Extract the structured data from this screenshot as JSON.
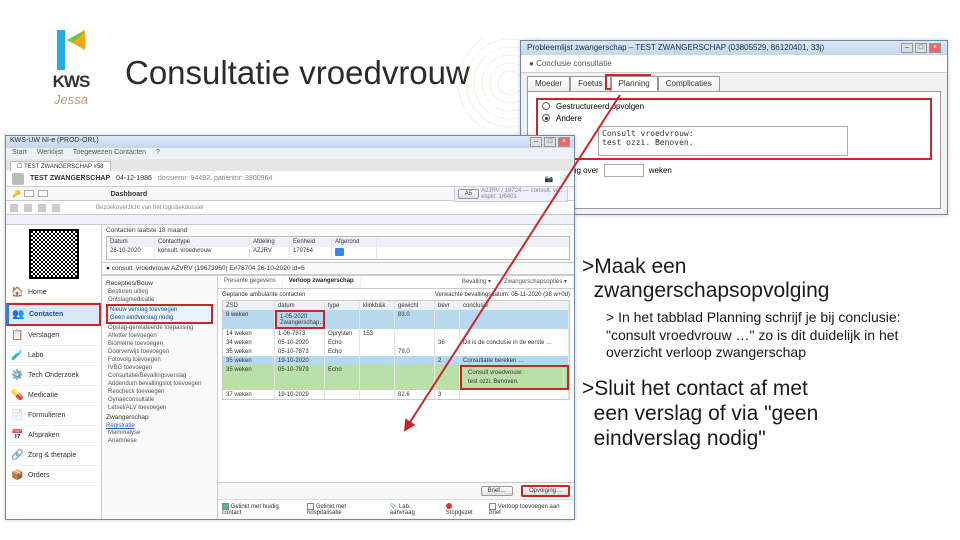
{
  "logo": {
    "text": "KWS",
    "sub": "Jessa"
  },
  "main_title": "Consultatie vroedvrouw",
  "popup": {
    "title": "Probleemlijst zwangerschap – TEST ZWANGERSCHAP (03805529, 86120401, 33j)",
    "subtitle": "Conclusie consultatie",
    "tabs": [
      "Moeder",
      "Foetus",
      "Planning",
      "Complicaties"
    ],
    "active_tab": "Planning",
    "radios": {
      "r1": "Gestructureerd opvolgen",
      "r2": "Andere"
    },
    "textarea_lines": [
      "Consult vroedvrouw:",
      "test ozzi. Benoven."
    ],
    "followup_label": "Raadpleging over",
    "followup_unit": "weken"
  },
  "app_window": {
    "title": "KWS-UW NI-e (PROD-ORL)",
    "menu": [
      "Start",
      "Werklijst",
      "Toegewezen Contacten",
      "?"
    ],
    "tab_label": "TEST ZWANGERSCHAP #58",
    "patient": {
      "name": "TEST ZWANGERSCHAP",
      "dob": "04-12-1986",
      "info": "dossiernr: 94492. patiëntnr: 3800964",
      "key_label": "A5"
    },
    "dashboard_label": "Dashboard",
    "right_widget": {
      "l1": "A2JRV / 19724 — consult. vr…",
      "l2": "esplit: 1/6401"
    },
    "breadcrumb": "Bezoekoverzicht van het logistiekdossier"
  },
  "sidebar": [
    {
      "icon": "🏠",
      "label": "Home"
    },
    {
      "icon": "👥",
      "label": "Contacten",
      "active": true
    },
    {
      "icon": "📋",
      "label": "Verslagen"
    },
    {
      "icon": "🧪",
      "label": "Labo"
    },
    {
      "icon": "⚙️",
      "label": "Tech Onderzoek"
    },
    {
      "icon": "💊",
      "label": "Medicatie"
    },
    {
      "icon": "📄",
      "label": "Formulieren"
    },
    {
      "icon": "📅",
      "label": "Afspraken"
    },
    {
      "icon": "🔗",
      "label": "Zorg & therapie"
    },
    {
      "icon": "📦",
      "label": "Orders"
    }
  ],
  "contacts_panel": {
    "header": "Contacten laatste 18 maand",
    "cols": [
      "Datum",
      "Contacttype",
      "Afdeling",
      "Eenheid",
      "Afgerond"
    ],
    "row": {
      "datum": "28-10-2020",
      "type": "konsult. vroedvrouw",
      "afd": "AZJRV",
      "eenh": "179764",
      "badge": true
    }
  },
  "consult": {
    "title": "consult. vroedvrouw AZVRV (19673960)  E#78704  26-10-2020 id=6",
    "left": {
      "sec1_title": "Recepties/Bouw",
      "sec1_items": [
        "Besturen uitleg",
        "Ontslagmedicatie"
      ],
      "sec2_items": [
        "Nieuw verslag toevoegen",
        "Geen eindverslag nodig"
      ],
      "sec3_items": [
        "Opslag-gerelateerde toepassing",
        "Afletter toevoegen",
        "Biometrie toevoegen",
        "Doorverwijs toevoegen",
        "Fotovolg toevoegen",
        "IVBG toevoegen",
        "Consultatie/Bevallingsverslag",
        "Addendum bevallingslot toevoegen",
        "Reocheck toevoegen",
        "Gynaeconsultatie",
        "Letsel/ALV toevoegen"
      ],
      "sec4_title": "Zwangerschap",
      "sec4_link": "Registratie",
      "sec4_items": [
        "Mammalyse",
        "Anamnese"
      ]
    },
    "tabs": [
      "Presente gegevens",
      "Verloop zwangerschap"
    ],
    "tabs_right": [
      "Bevalling ▾",
      "Zwangerschapsopties ▾"
    ],
    "header_left": "Geplande ambulante contacten",
    "header_right": "Verwachte bevallingsdatum: 05-11-2020 (38 w+0d)",
    "cols": [
      "ZSD",
      "datum",
      "type",
      "klinkb&k",
      "gewicht",
      "bevr",
      "conclusie"
    ],
    "rows": [
      {
        "z": "8 weken",
        "d": "1-05-2020",
        "t": "Zwangerschap…",
        "k": "",
        "g": "83.0",
        "b": "",
        "c": "",
        "cls": "row-blue",
        "redcell": true
      },
      {
        "z": "14 weken",
        "d": "1-06-7873",
        "t": "Oprysten",
        "k": "153",
        "g": "",
        "b": "",
        "c": ""
      },
      {
        "z": "34 weken",
        "d": "05-10-2020",
        "t": "Echo",
        "k": "",
        "g": "",
        "b": "36",
        "c": "Dit is de conclusie in de eerste …"
      },
      {
        "z": "35 weken",
        "d": "05-10-7873",
        "t": "Echo",
        "k": "",
        "g": "79.0",
        "b": "",
        "c": ""
      },
      {
        "z": "35 weken",
        "d": "19-10-2020",
        "t": "",
        "k": "",
        "g": "",
        "b": "2",
        "c": "Consultatie bereken …",
        "cls": "row-blue"
      },
      {
        "z": "35 weken",
        "d": "05-10-7879",
        "t": "Echo",
        "k": "",
        "g": "",
        "b": "",
        "c": "",
        "cls": "row-green",
        "redconc": true,
        "conc_l1": "Consult vroedvrouw:",
        "conc_l2": "test ozzi. Benoven."
      },
      {
        "z": "37 weken",
        "d": "19-10-2029",
        "t": "",
        "k": "",
        "g": "82.6",
        "b": "3",
        "c": ""
      }
    ],
    "bottom_btns": {
      "brief": "Brief…",
      "opvolging": "Opvolging…"
    },
    "bottom2": {
      "chk1": "Gelinkt met huidig contact",
      "chk2": "Gelinkt met hospitalisatie",
      "lab": "Lab. aanvraag",
      "stop": "Stopgezet",
      "add": "Verloop toevoegen aan brief"
    }
  },
  "instructions": {
    "h1_a": ">Maak een",
    "h1_b": "zwangerschapsopvolging",
    "sub": "> In het tabblad Planning schrijf je bij conclusie: \"consult vroedvrouw …\" zo is dit duidelijk in het overzicht verloop zwangerschap",
    "h2_a": ">Sluit het contact af met",
    "h2_b": "een verslag of via \"geen",
    "h2_c": "eindverslag nodig\""
  }
}
